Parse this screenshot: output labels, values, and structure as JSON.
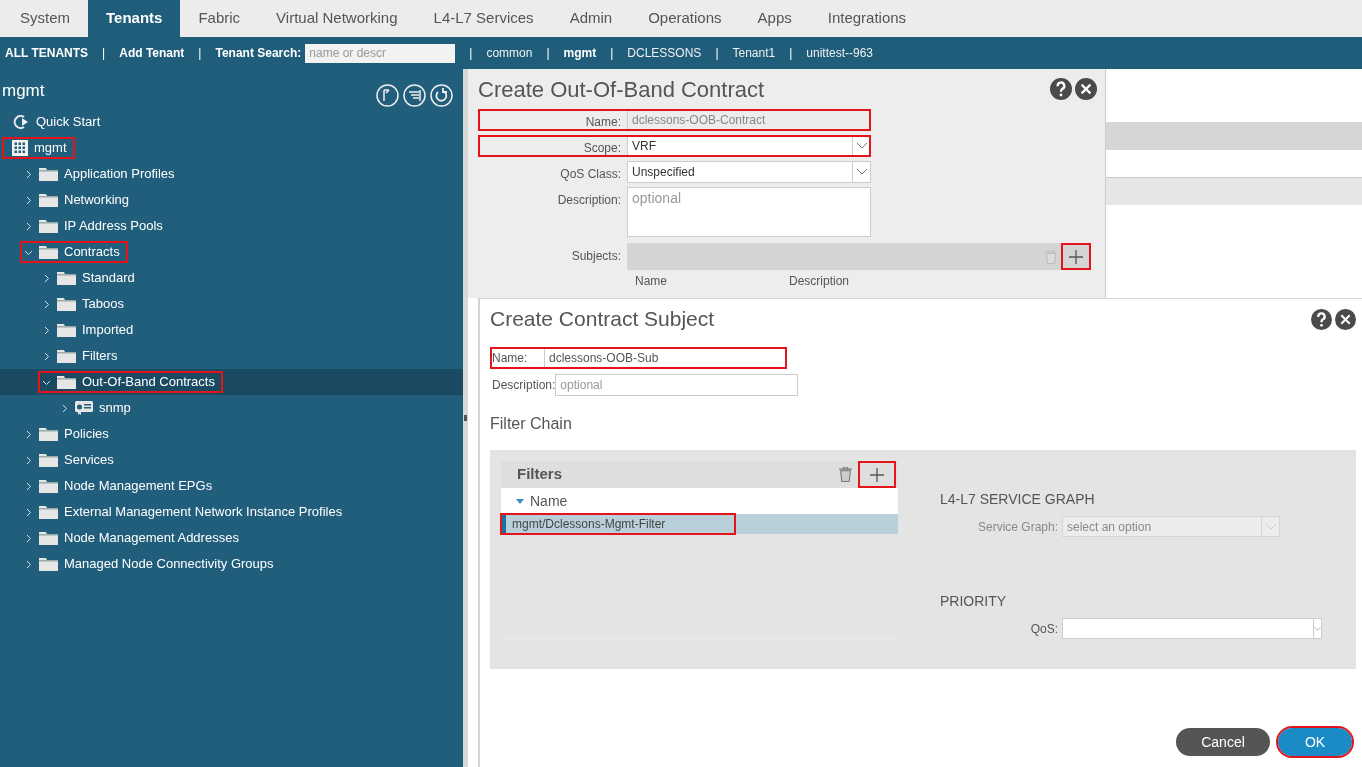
{
  "top_tabs": [
    {
      "label": "System",
      "selected": false
    },
    {
      "label": "Tenants",
      "selected": true
    },
    {
      "label": "Fabric",
      "selected": false
    },
    {
      "label": "Virtual Networking",
      "selected": false
    },
    {
      "label": "L4-L7 Services",
      "selected": false
    },
    {
      "label": "Admin",
      "selected": false
    },
    {
      "label": "Operations",
      "selected": false
    },
    {
      "label": "Apps",
      "selected": false
    },
    {
      "label": "Integrations",
      "selected": false
    }
  ],
  "tenant_bar": [
    {
      "kind": "link",
      "label": "ALL TENANTS"
    },
    {
      "kind": "separator",
      "label": "|"
    },
    {
      "kind": "link",
      "label": "Add Tenant"
    },
    {
      "kind": "separator",
      "label": "|"
    },
    {
      "kind": "search",
      "label": "Tenant Search:",
      "placeholder": "name or descr"
    },
    {
      "kind": "separator",
      "label": "|"
    },
    {
      "kind": "tenant",
      "label": "common",
      "selected": false
    },
    {
      "kind": "separator",
      "label": "|"
    },
    {
      "kind": "tenant",
      "label": "mgmt",
      "selected": true
    },
    {
      "kind": "separator",
      "label": "|"
    },
    {
      "kind": "tenant",
      "label": "DCLESSONS",
      "selected": false
    },
    {
      "kind": "separator",
      "label": "|"
    },
    {
      "kind": "tenant",
      "label": "Tenant1",
      "selected": false
    },
    {
      "kind": "separator",
      "label": "|"
    },
    {
      "kind": "tenant",
      "label": "unittest--963",
      "selected": false
    }
  ],
  "sidebar": {
    "title": "mgmt",
    "tree": [
      {
        "label": "Quick Start",
        "kind": "quickstart",
        "selected": false,
        "highlighted": false
      },
      {
        "label": "mgmt",
        "kind": "tenant",
        "selected": false,
        "highlighted": true,
        "children": [
          {
            "label": "Application Profiles",
            "kind": "folder",
            "expanded": false,
            "selected": false,
            "highlighted": false
          },
          {
            "label": "Networking",
            "kind": "folder",
            "expanded": false,
            "selected": false,
            "highlighted": false
          },
          {
            "label": "IP Address Pools",
            "kind": "folder",
            "expanded": false,
            "selected": false,
            "highlighted": false
          },
          {
            "label": "Contracts",
            "kind": "folder",
            "expanded": true,
            "selected": false,
            "highlighted": true,
            "children": [
              {
                "label": "Standard",
                "kind": "folder",
                "expanded": false,
                "selected": false,
                "highlighted": false
              },
              {
                "label": "Taboos",
                "kind": "folder",
                "expanded": false,
                "selected": false,
                "highlighted": false
              },
              {
                "label": "Imported",
                "kind": "folder",
                "expanded": false,
                "selected": false,
                "highlighted": false
              },
              {
                "label": "Filters",
                "kind": "folder",
                "expanded": false,
                "selected": false,
                "highlighted": false
              },
              {
                "label": "Out-Of-Band Contracts",
                "kind": "folder",
                "expanded": true,
                "selected": true,
                "highlighted": true,
                "children": [
                  {
                    "label": "snmp",
                    "kind": "contract",
                    "expanded": false,
                    "selected": false,
                    "highlighted": false
                  }
                ]
              }
            ]
          },
          {
            "label": "Policies",
            "kind": "folder",
            "expanded": false,
            "selected": false,
            "highlighted": false
          },
          {
            "label": "Services",
            "kind": "folder",
            "expanded": false,
            "selected": false,
            "highlighted": false
          },
          {
            "label": "Node Management EPGs",
            "kind": "folder",
            "expanded": false,
            "selected": false,
            "highlighted": false
          },
          {
            "label": "External Management Network Instance Profiles",
            "kind": "folder",
            "expanded": false,
            "selected": false,
            "highlighted": false
          },
          {
            "label": "Node Management Addresses",
            "kind": "folder",
            "expanded": false,
            "selected": false,
            "highlighted": false
          },
          {
            "label": "Managed Node Connectivity Groups",
            "kind": "folder",
            "expanded": false,
            "selected": false,
            "highlighted": false
          }
        ]
      }
    ]
  },
  "contract_dialog": {
    "title": "Create Out-Of-Band Contract",
    "fields": [
      {
        "kind": "text",
        "label": "Name:",
        "value": "dclessons-OOB-Contract",
        "disabled": true,
        "highlighted": true
      },
      {
        "kind": "select",
        "label": "Scope:",
        "value": "VRF",
        "disabled": false,
        "highlighted": true
      },
      {
        "kind": "select",
        "label": "QoS Class:",
        "value": "Unspecified",
        "disabled": false,
        "highlighted": false
      },
      {
        "kind": "textarea",
        "label": "Description:",
        "placeholder": "optional",
        "disabled": false,
        "highlighted": false
      }
    ],
    "subjects": {
      "label": "Subjects:",
      "add_highlighted": true,
      "columns": [
        "Name",
        "Description"
      ]
    }
  },
  "subject_dialog": {
    "title": "Create Contract Subject",
    "fields": [
      {
        "label": "Name:",
        "value": "dclessons-OOB-Sub",
        "highlighted": true
      },
      {
        "label": "Description:",
        "placeholder": "optional",
        "highlighted": false
      }
    ],
    "filter_chain": {
      "title": "Filter Chain",
      "filters_title": "Filters",
      "add_highlighted": true,
      "column": "Name",
      "rows": [
        {
          "label": "mgmt/Dclessons-Mgmt-Filter",
          "selected": true,
          "highlighted": true
        }
      ],
      "service_graph": {
        "heading": "L4-L7 SERVICE GRAPH",
        "label": "Service Graph:",
        "placeholder": "select an option",
        "disabled": true
      },
      "priority": {
        "heading": "PRIORITY",
        "label": "QoS:"
      }
    },
    "buttons": [
      {
        "kind": "cancel",
        "label": "Cancel",
        "highlighted": false
      },
      {
        "kind": "ok",
        "label": "OK",
        "highlighted": true
      }
    ]
  }
}
